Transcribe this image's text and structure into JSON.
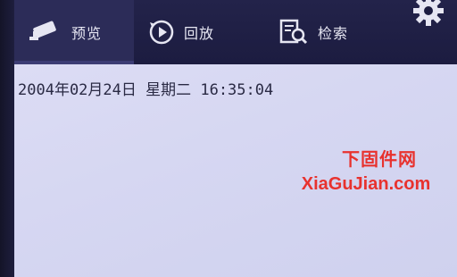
{
  "nav": {
    "tabs": [
      {
        "label": "预览",
        "icon": "camera-icon",
        "active": true
      },
      {
        "label": "回放",
        "icon": "playback-icon",
        "active": false
      },
      {
        "label": "检索",
        "icon": "search-document-icon",
        "active": false
      }
    ],
    "settings_icon": "gear-icon"
  },
  "video": {
    "osd_datetime": "2004年02月24日 星期二 16:35:04"
  },
  "watermark": {
    "line1": "下固件网",
    "line2": "XiaGuJian.com",
    "color": "#e8322e"
  },
  "colors": {
    "topbar": "#1c1c40",
    "video_bg": "#d6d7f2",
    "osd_text": "#2a2a44"
  }
}
